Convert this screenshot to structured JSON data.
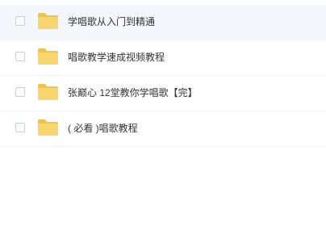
{
  "colors": {
    "folder": "#f8d56d",
    "folder_tab": "#f0c34d",
    "selected_row_bg": "#f4f8fd",
    "divider": "#eef1f5",
    "text": "#333333"
  },
  "files": [
    {
      "name": "学唱歌从入门到精通",
      "type": "folder-icon",
      "selected": true
    },
    {
      "name": "唱歌教学速成视频教程",
      "type": "folder-icon",
      "selected": false
    },
    {
      "name": "张巅心 12堂教你学唱歌【完】",
      "type": "folder-icon",
      "selected": false
    },
    {
      "name": "( 必看 )唱歌教程",
      "type": "folder-icon",
      "selected": false
    }
  ]
}
